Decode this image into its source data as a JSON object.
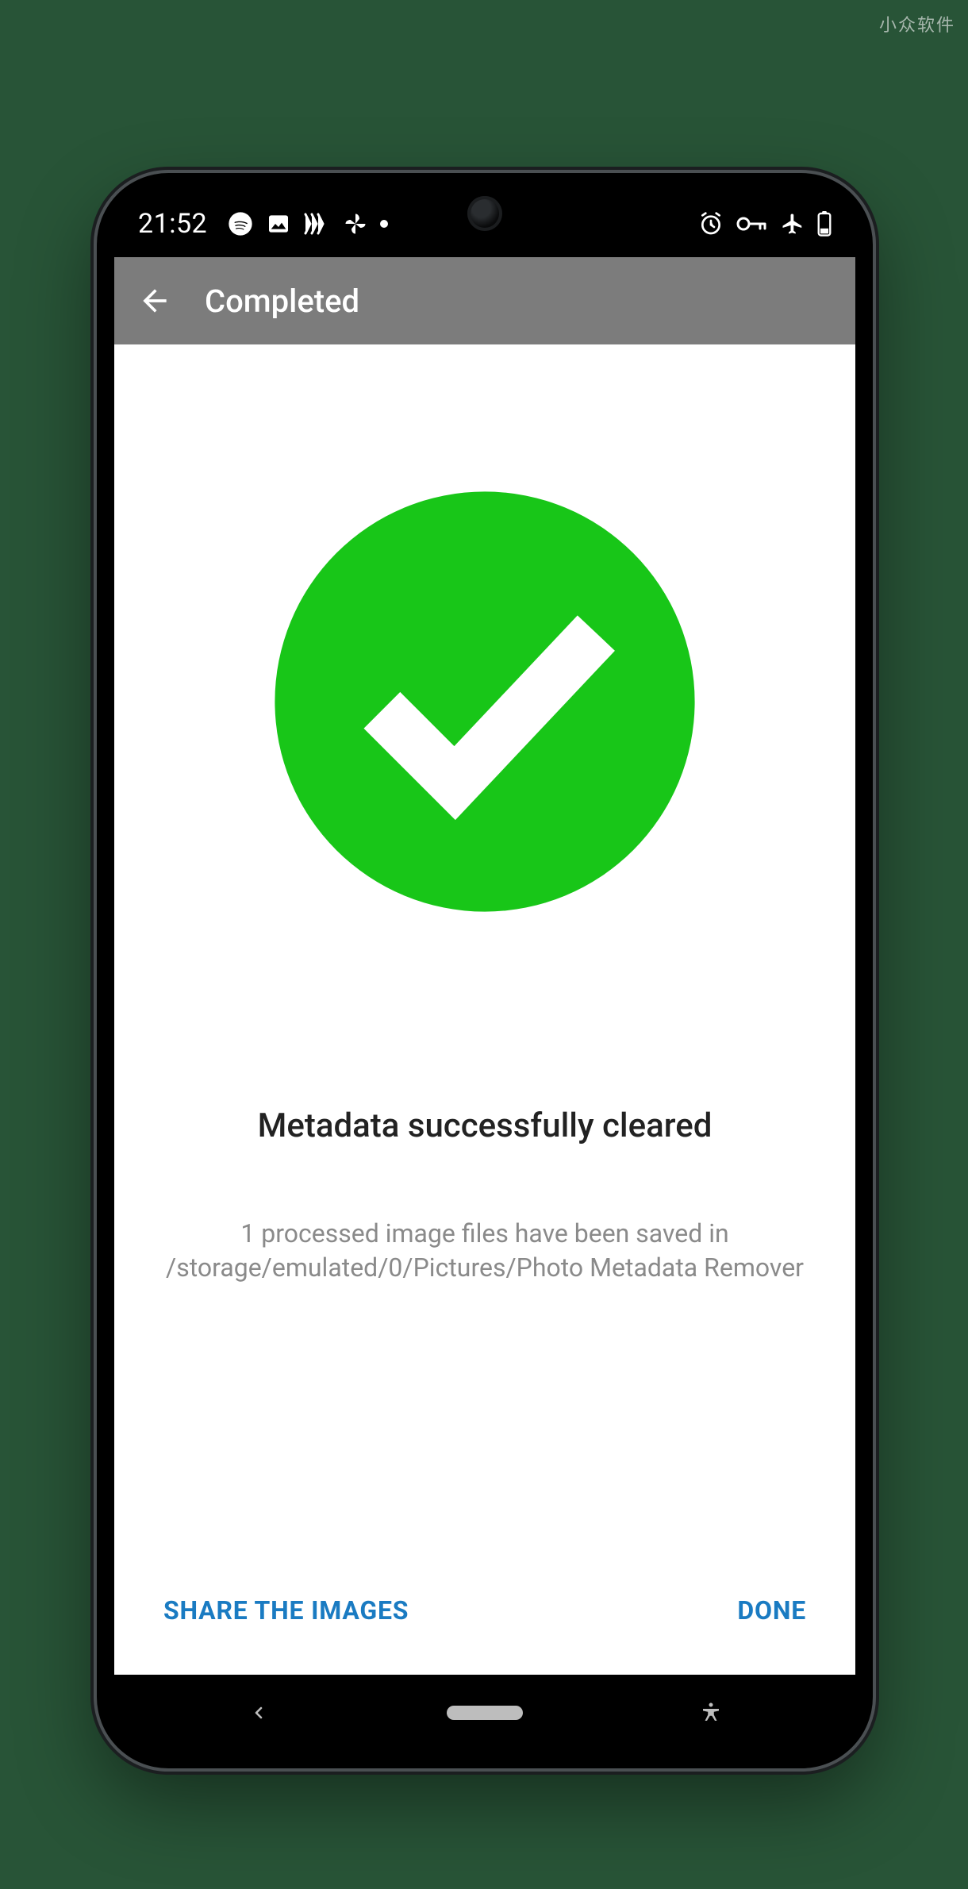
{
  "watermark": "小众软件",
  "status": {
    "time": "21:52",
    "icons_left": [
      "spotify-icon",
      "image-icon",
      "wave-icon",
      "pinwheel-icon",
      "dot-icon"
    ],
    "icons_right": [
      "alarm-icon",
      "key-icon",
      "airplane-icon",
      "battery-icon"
    ]
  },
  "appbar": {
    "title": "Completed"
  },
  "main": {
    "success_icon": "checkmark-circle-icon",
    "headline": "Metadata successfully cleared",
    "subtext": "1 processed image files have been saved in /storage/emulated/0/Pictures/Photo Metadata Remover"
  },
  "actions": {
    "share_label": "SHARE THE IMAGES",
    "done_label": "DONE"
  },
  "colors": {
    "accent": "#1a7bc2",
    "success": "#18c618",
    "appbar": "#7c7c7c"
  }
}
